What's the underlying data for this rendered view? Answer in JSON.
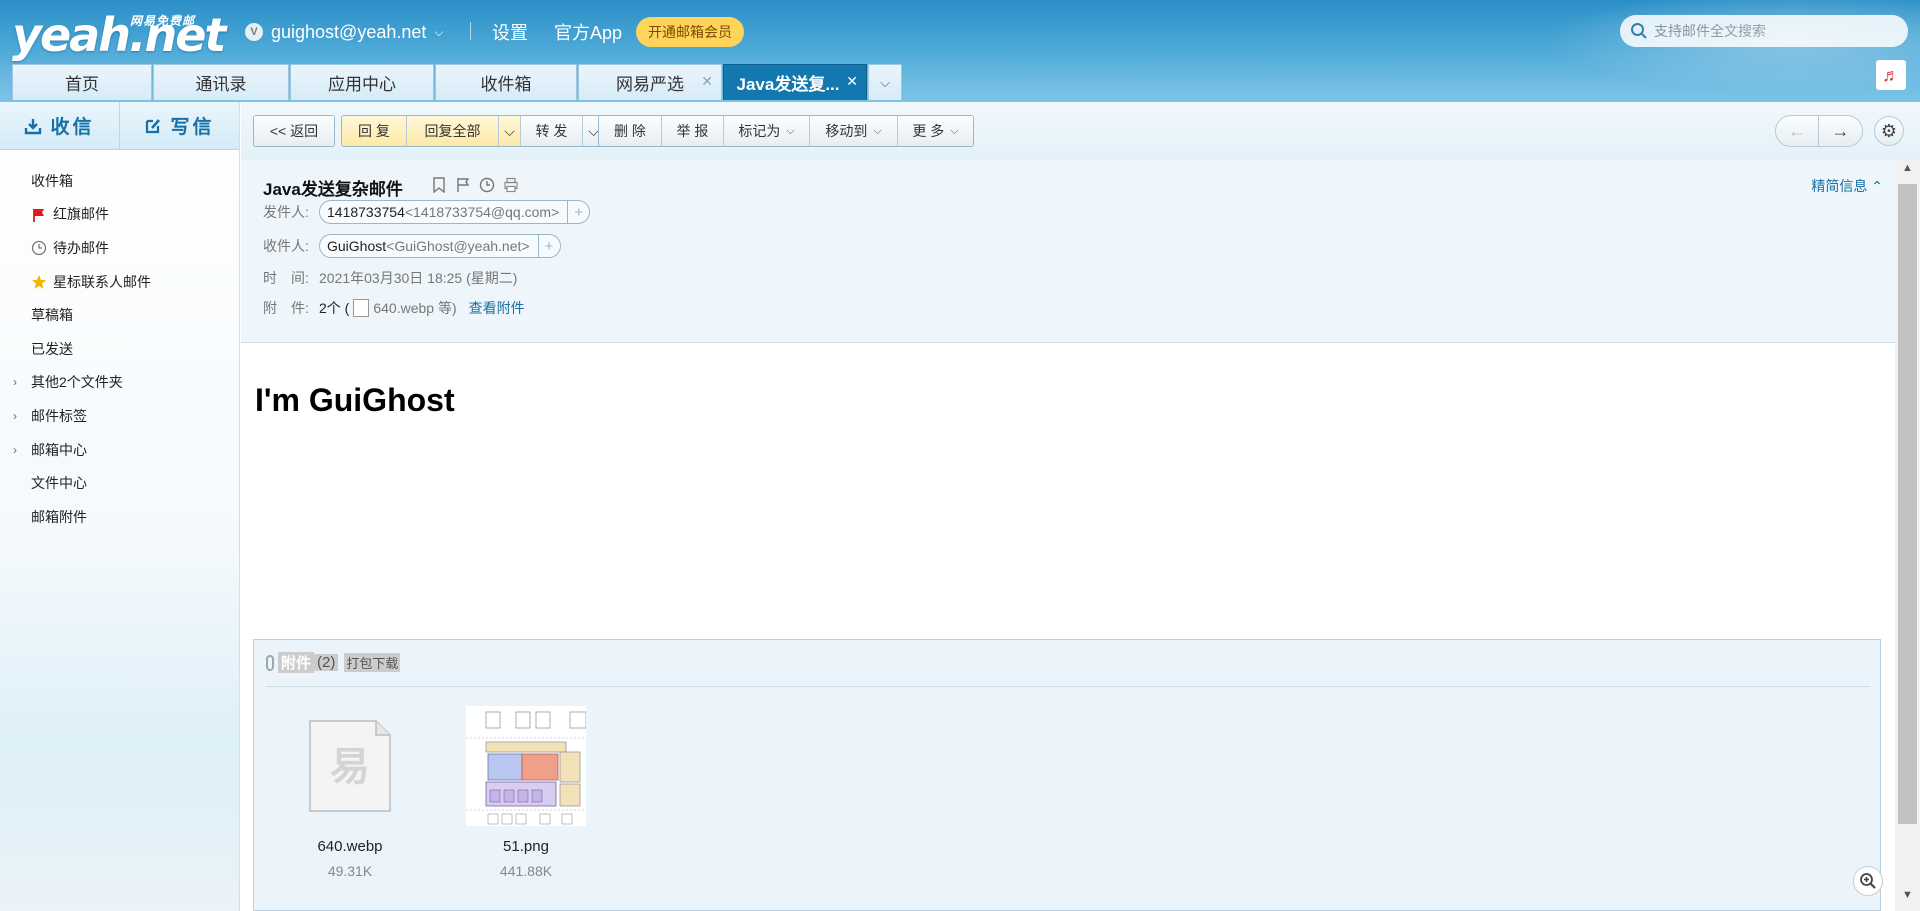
{
  "header": {
    "logo_main": "yeah.net",
    "logo_sub": "网易免费邮",
    "account_email": "guighost@yeah.net",
    "account_badge": "V",
    "links": [
      "设置",
      "官方App"
    ],
    "vip_button": "开通邮箱会员",
    "search_placeholder": "支持邮件全文搜索"
  },
  "tabs": [
    {
      "label": "首页",
      "closable": false,
      "active": false
    },
    {
      "label": "通讯录",
      "closable": false,
      "active": false
    },
    {
      "label": "应用中心",
      "closable": false,
      "active": false
    },
    {
      "label": "收件箱",
      "closable": false,
      "active": false
    },
    {
      "label": "网易严选",
      "closable": true,
      "active": false
    },
    {
      "label": "Java发送复...",
      "closable": true,
      "active": true
    }
  ],
  "sidebar": {
    "receive_label": "收信",
    "compose_label": "写信",
    "folders": [
      {
        "label": "收件箱"
      },
      {
        "label": "红旗邮件",
        "icon": "red-flag-icon"
      },
      {
        "label": "待办邮件",
        "icon": "clock-icon"
      },
      {
        "label": "星标联系人邮件",
        "icon": "star-icon"
      },
      {
        "label": "草稿箱"
      },
      {
        "label": "已发送"
      },
      {
        "label": "其他2个文件夹",
        "expandable": true
      },
      {
        "label": "邮件标签",
        "expandable": true
      },
      {
        "label": "邮箱中心",
        "expandable": true
      },
      {
        "label": "文件中心"
      },
      {
        "label": "邮箱附件"
      }
    ]
  },
  "toolbar": {
    "back": "<< 返回",
    "reply": "回 复",
    "reply_all": "回复全部",
    "forward": "转 发",
    "delete": "删 除",
    "report": "举 报",
    "mark_as": "标记为",
    "move_to": "移动到",
    "more": "更 多"
  },
  "mail": {
    "subject": "Java发送复杂邮件",
    "detail_link": "精简信息",
    "from_label": "发件人:",
    "from_name": "1418733754",
    "from_email": "<1418733754@qq.com>",
    "to_label": "收件人:",
    "to_name": "GuiGhost",
    "to_email": "<GuiGhost@yeah.net>",
    "time_label": "时　间:",
    "time_value": "2021年03月30日 18:25 (星期二)",
    "attach_label": "附　件:",
    "attach_count": "2个 (",
    "attach_first": "640.webp 等)",
    "attach_view": "查看附件",
    "body": "I'm GuiGhost"
  },
  "attachments": {
    "title": "附件",
    "count": "(2)",
    "download_all": "打包下载",
    "items": [
      {
        "name": "640.webp",
        "size": "49.31K"
      },
      {
        "name": "51.png",
        "size": "441.88K"
      }
    ]
  },
  "colors": {
    "brand_blue": "#1571a8",
    "active_tab": "#1478b0",
    "vip_yellow": "#ffd45a",
    "header_top": "#2b8fc7"
  }
}
